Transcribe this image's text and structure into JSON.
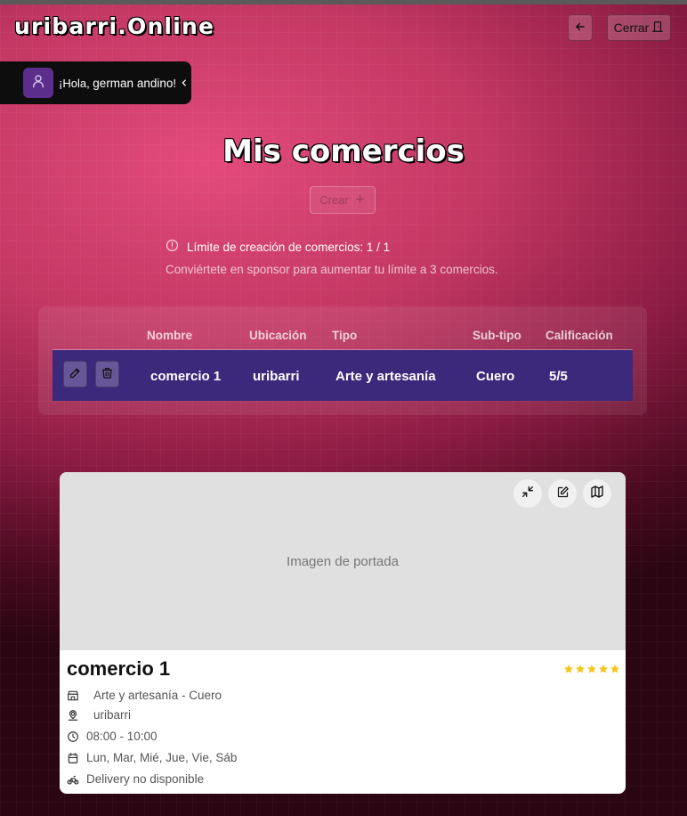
{
  "app": {
    "brand": "uribarri.Online"
  },
  "header": {
    "back_icon": "arrow-left-icon",
    "close_label": "Cerrar",
    "close_icon": "door-icon"
  },
  "greeting": {
    "prefix": "¡Hola, ",
    "name": "german andino",
    "suffix": "!"
  },
  "page": {
    "title": "Mis comercios"
  },
  "create": {
    "label": "Crear"
  },
  "limit": {
    "line1": "Límite de creación de comercios: 1 / 1",
    "line2": "Conviértete en sponsor para aumentar tu límite a 3 comercios."
  },
  "table": {
    "columns": [
      "Nombre",
      "Ubicación",
      "Tipo",
      "Sub-tipo",
      "Calificación"
    ],
    "rows": [
      {
        "nombre": "comercio 1",
        "ubicacion": "uribarri",
        "tipo": "Arte y artesanía",
        "subtipo": "Cuero",
        "calificacion": "5/5"
      }
    ]
  },
  "card": {
    "cover_label": "Imagen de portada",
    "title": "comercio 1",
    "rating": 5,
    "category": "Arte y artesanía - Cuero",
    "location": "uribarri",
    "hours": "08:00 - 10:00",
    "days": "Lun, Mar, Mié, Jue, Vie, Sáb",
    "delivery": "Delivery no disponible"
  },
  "colors": {
    "accent_row": "#3b2a7c",
    "avatar": "#5b2e8c",
    "star": "#f5c518"
  }
}
